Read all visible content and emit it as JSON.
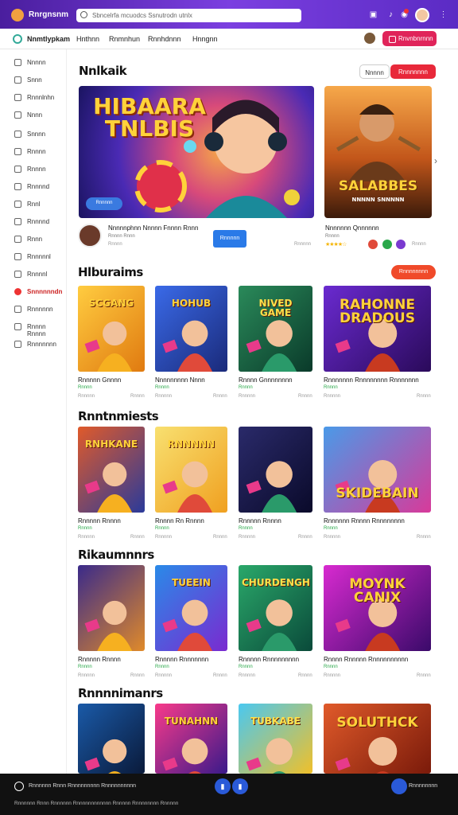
{
  "topbar": {
    "brand": "Rnrgnsnm",
    "search_placeholder": "Sbncelrfa mcuodcs Ssnutrodn utnlx"
  },
  "nav": {
    "brand": "Nnmtlypkam",
    "items": [
      "Hnthnn",
      "Rnmnhun",
      "Rnnhdnnn",
      "Hnngnn"
    ],
    "button": "Rnvnbnrnnn"
  },
  "sidebar": {
    "items": [
      {
        "label": "Nnnnn",
        "active": false
      },
      {
        "label": "Snnn",
        "active": false
      },
      {
        "label": "Rnnnlnhn",
        "active": false
      },
      {
        "label": "Nnnn",
        "active": false
      },
      {
        "label": "Snnnn",
        "active": false
      },
      {
        "label": "Rnnnn",
        "active": false
      },
      {
        "label": "Rnnnn",
        "active": false
      },
      {
        "label": "Rnnnnd",
        "active": false
      },
      {
        "label": "Rnnl",
        "active": false
      },
      {
        "label": "Rnnnnd",
        "active": false
      },
      {
        "label": "Rnnn",
        "active": false
      },
      {
        "label": "Rnnnnnl",
        "active": false
      },
      {
        "label": "Rnnnnl",
        "active": false
      },
      {
        "label": "Snnnnnndn",
        "active": true
      },
      {
        "label": "Rnnnnnn",
        "active": false
      },
      {
        "label": "Rnnnn Rnnnn",
        "active": false
      },
      {
        "label": "Rnnnnnnn",
        "active": false
      }
    ]
  },
  "featured": {
    "heading": "Nnlkaik",
    "seg_left": "Nnnnn",
    "seg_right": "Rnnnnnnn",
    "hero_art": "HIBAARA TNLBIS",
    "hero_chip": "Rnnnnn",
    "hero_title": "Nnnnnphnn Nnnnn Fnnnn Rnnn",
    "hero_sub": "Rnnnn Rnnn",
    "hero_meta": "Rnnnn",
    "hero_stat": "Rnnnnn",
    "hero_button": "Rnnnnn",
    "side_art": "SALABBES",
    "side_art_sub": "NNNNN SNNNNN",
    "side_title": "Nnnnnnn Qnnnnnn",
    "side_stat": "Rnnnn",
    "rating": 4,
    "side_meta": "Rnnnn"
  },
  "section_btn": "Rnnnnnnnn",
  "sections": [
    {
      "heading": "Hlburaims",
      "cards": [
        {
          "art": "SCGANG",
          "title": "Rnnnnn Gnnnn",
          "sub": "Rnnnn",
          "meta": "Rnnnnn",
          "stat": "Rnnnn"
        },
        {
          "art": "HOHUB",
          "title": "Nnnnnnnnn Nnnn",
          "sub": "Rnnnn",
          "meta": "Rnnnnn",
          "stat": "Rnnnn"
        },
        {
          "art": "NIVED GAME",
          "title": "Rnnnn Gnnnnnnnn",
          "sub": "Rnnnn",
          "meta": "Rnnnnn",
          "stat": "Rnnnn"
        },
        {
          "art": "RAHONNE DRADOUS",
          "title": "Rnnnnnnn Rnnnnnnnn Rnnnnnnn",
          "sub": "Rnnnn",
          "meta": "Rnnnnn",
          "stat": "Rnnnn"
        }
      ]
    },
    {
      "heading": "Rnntnmiests",
      "cards": [
        {
          "art": "RNHKANE",
          "title": "Rnnnnn Rnnnn",
          "sub": "Rnnnn",
          "meta": "Rnnnnn",
          "stat": "Rnnnn"
        },
        {
          "art": "RNNNNN",
          "title": "Rnnnn Rn Rnnnn",
          "sub": "Rnnnn",
          "meta": "Rnnnnn",
          "stat": "Rnnnn"
        },
        {
          "art": "",
          "title": "Rnnnnn Rnnnn",
          "sub": "Rnnnn",
          "meta": "Rnnnnn",
          "stat": "Rnnnn"
        },
        {
          "art": "SKIDEBAIN",
          "title": "Rnnnnnn Rnnnn Rnnnnnnnn",
          "sub": "Rnnnn",
          "meta": "Rnnnnn",
          "stat": "Rnnnn"
        }
      ]
    },
    {
      "heading": "Rikaumnnrs",
      "cards": [
        {
          "art": "",
          "title": "Rnnnnn Rnnnn",
          "sub": "Rnnnn",
          "meta": "Rnnnnn",
          "stat": "Rnnnn"
        },
        {
          "art": "TUEEIN",
          "title": "Rnnnnn Rnnnnnnn",
          "sub": "Rnnnn",
          "meta": "Rnnnnn",
          "stat": "Rnnnn"
        },
        {
          "art": "CHURDENGH",
          "title": "Rnnnnn Rnnnnnnnnn",
          "sub": "Rnnnn",
          "meta": "Rnnnnn",
          "stat": "Rnnnn"
        },
        {
          "art": "MOYNK CANIX",
          "title": "Rnnnn Rnnnnn Rnnnnnnnnnn",
          "sub": "Rnnnn",
          "meta": "Rnnnnn",
          "stat": "Rnnnn"
        }
      ]
    },
    {
      "heading": "Rnnnnimanrs",
      "cards": [
        {
          "art": "",
          "title": "",
          "sub": "",
          "meta": "",
          "stat": ""
        },
        {
          "art": "TUNAHNN",
          "title": "",
          "sub": "",
          "meta": "",
          "stat": ""
        },
        {
          "art": "TUBKABE",
          "title": "",
          "sub": "",
          "meta": "",
          "stat": ""
        },
        {
          "art": "SOLUTHCK",
          "title": "",
          "sub": "",
          "meta": "",
          "stat": ""
        }
      ]
    }
  ],
  "bottombar": {
    "line1": "Rnnnnnn Rnnn Rnnnnnnnnn Rnnnnnnnnnn",
    "line2": "Rnnnnnn Rnnn Rnnnnnn Rnnnnnnnnnnnn Rnnnnn Rnnnnnnnn Rnnnnn",
    "right_label": "Rnnnnnnnn"
  }
}
